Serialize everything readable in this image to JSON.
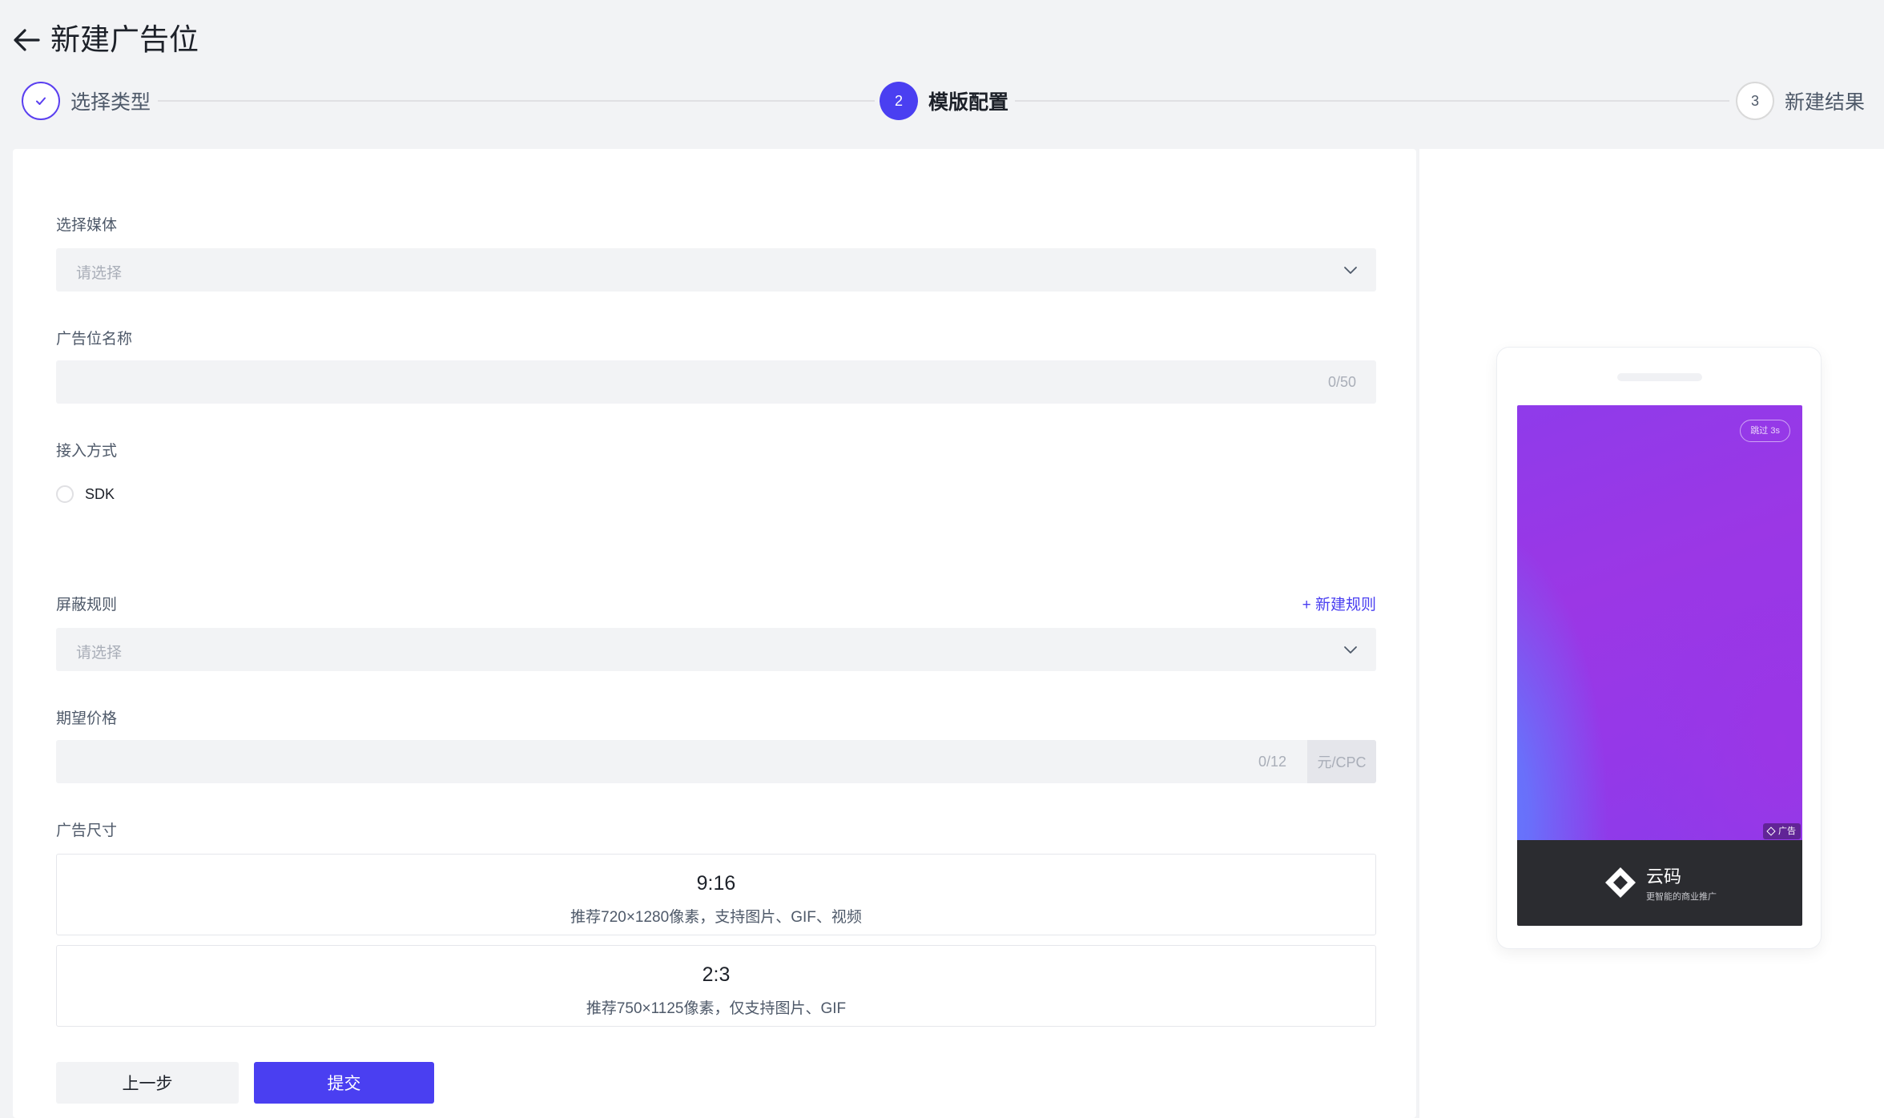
{
  "header": {
    "title": "新建广告位",
    "back_icon": "arrow-left-icon"
  },
  "steps": [
    {
      "number": "✓",
      "label": "选择类型",
      "state": "done"
    },
    {
      "number": "2",
      "label": "模版配置",
      "state": "active"
    },
    {
      "number": "3",
      "label": "新建结果",
      "state": "todo"
    }
  ],
  "form": {
    "media": {
      "label": "选择媒体",
      "placeholder": "请选择"
    },
    "name": {
      "label": "广告位名称",
      "counter": "0/50"
    },
    "access": {
      "label": "接入方式",
      "option": "SDK"
    },
    "block_rules": {
      "label": "屏蔽规则",
      "placeholder": "请选择",
      "add_link": "+ 新建规则"
    },
    "price": {
      "label": "期望价格",
      "counter": "0/12",
      "suffix": "元/CPC"
    },
    "size": {
      "label": "广告尺寸",
      "options": [
        {
          "ratio": "9:16",
          "desc": "推荐720×1280像素，支持图片、GIF、视频"
        },
        {
          "ratio": "2:3",
          "desc": "推荐750×1125像素，仅支持图片、GIF"
        }
      ]
    }
  },
  "buttons": {
    "prev": "上一步",
    "submit": "提交"
  },
  "preview": {
    "skip": "跳过 3s",
    "ad_tag": "广告",
    "brand_name": "云码",
    "brand_slogan": "更智能的商业推广"
  },
  "colors": {
    "accent": "#4a3ff1",
    "ad_gradient_main": "#9b37e5",
    "ad_gradient_blue": "#5f7dff",
    "brand_bar": "#2b2c30"
  }
}
